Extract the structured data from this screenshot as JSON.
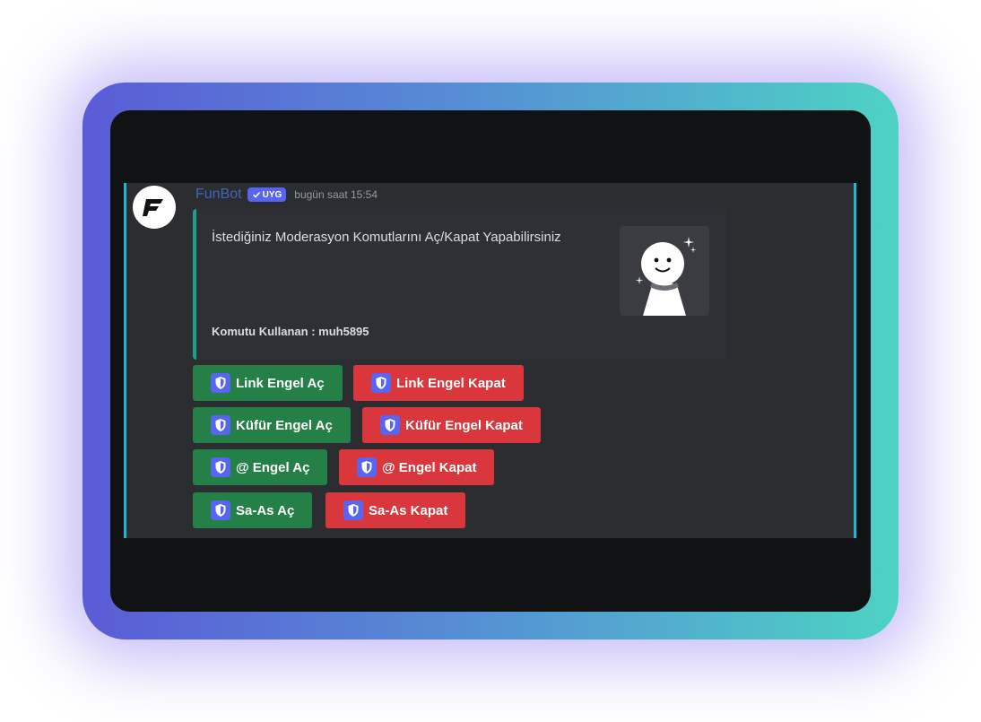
{
  "message": {
    "username": "FunBot",
    "app_tag": "UYG",
    "timestamp": "bugün saat 15:54",
    "avatar_icon": "funbot-logo-icon"
  },
  "embed": {
    "description": "İstediğiniz Moderasyon Komutlarını Aç/Kapat Yapabilirsiniz",
    "footer": "Komutu Kullanan : muh5895",
    "accent_color": "#1e9e8f"
  },
  "buttons": [
    {
      "label": "Link Engel Aç",
      "style": "success",
      "icon": "shield-icon"
    },
    {
      "label": "Link Engel Kapat",
      "style": "danger",
      "icon": "shield-icon"
    },
    {
      "label": "Küfür Engel Aç",
      "style": "success",
      "icon": "shield-icon"
    },
    {
      "label": "Küfür Engel Kapat",
      "style": "danger",
      "icon": "shield-icon"
    },
    {
      "label": "@ Engel Aç",
      "style": "success",
      "icon": "shield-icon"
    },
    {
      "label": "@ Engel Kapat",
      "style": "danger",
      "icon": "shield-icon"
    },
    {
      "label": "Sa-As Aç",
      "style": "success",
      "icon": "shield-icon"
    },
    {
      "label": "Sa-As Kapat",
      "style": "danger",
      "icon": "shield-icon"
    }
  ],
  "colors": {
    "success": "#248046",
    "danger": "#da373c",
    "brand": "#5865f2",
    "frame_gradient_start": "#5b5bd6",
    "frame_gradient_end": "#4dd3c4"
  }
}
